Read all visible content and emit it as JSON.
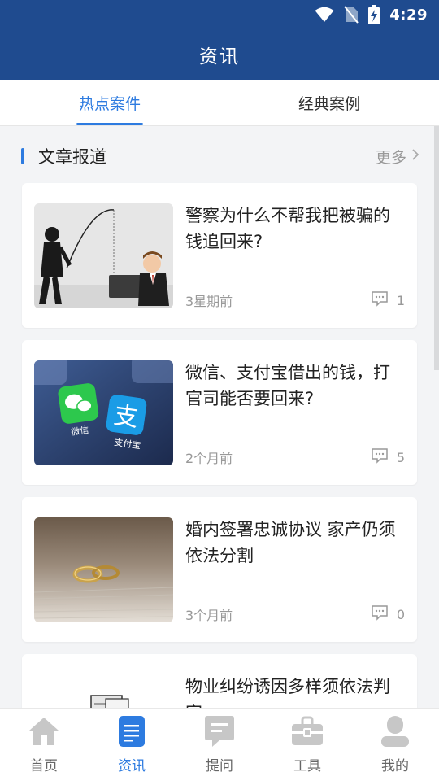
{
  "status": {
    "time": "4:29"
  },
  "appbar": {
    "title": "资讯"
  },
  "tabs": [
    {
      "label": "热点案件",
      "active": true
    },
    {
      "label": "经典案例",
      "active": false
    }
  ],
  "section": {
    "title": "文章报道",
    "more": "更多"
  },
  "articles": [
    {
      "title": "警察为什么不帮我把被骗的钱追回来?",
      "time": "3星期前",
      "comments": "1"
    },
    {
      "title": "微信、支付宝借出的钱，打官司能否要回来?",
      "time": "2个月前",
      "comments": "5",
      "thumb_labels": {
        "wechat": "微信",
        "alipay": "支付宝"
      }
    },
    {
      "title": "婚内签署忠诚协议 家产仍须依法分割",
      "time": "3个月前",
      "comments": "0"
    },
    {
      "title": "物业纠纷诱因多样须依法判定"
    }
  ],
  "nav": [
    {
      "label": "首页",
      "icon": "home-icon",
      "active": false
    },
    {
      "label": "资讯",
      "icon": "news-icon",
      "active": true
    },
    {
      "label": "提问",
      "icon": "question-icon",
      "active": false
    },
    {
      "label": "工具",
      "icon": "toolbox-icon",
      "active": false
    },
    {
      "label": "我的",
      "icon": "profile-icon",
      "active": false
    }
  ],
  "colors": {
    "primary": "#1f4b8f",
    "accent": "#2d7be0",
    "background": "#f3f4f6"
  }
}
